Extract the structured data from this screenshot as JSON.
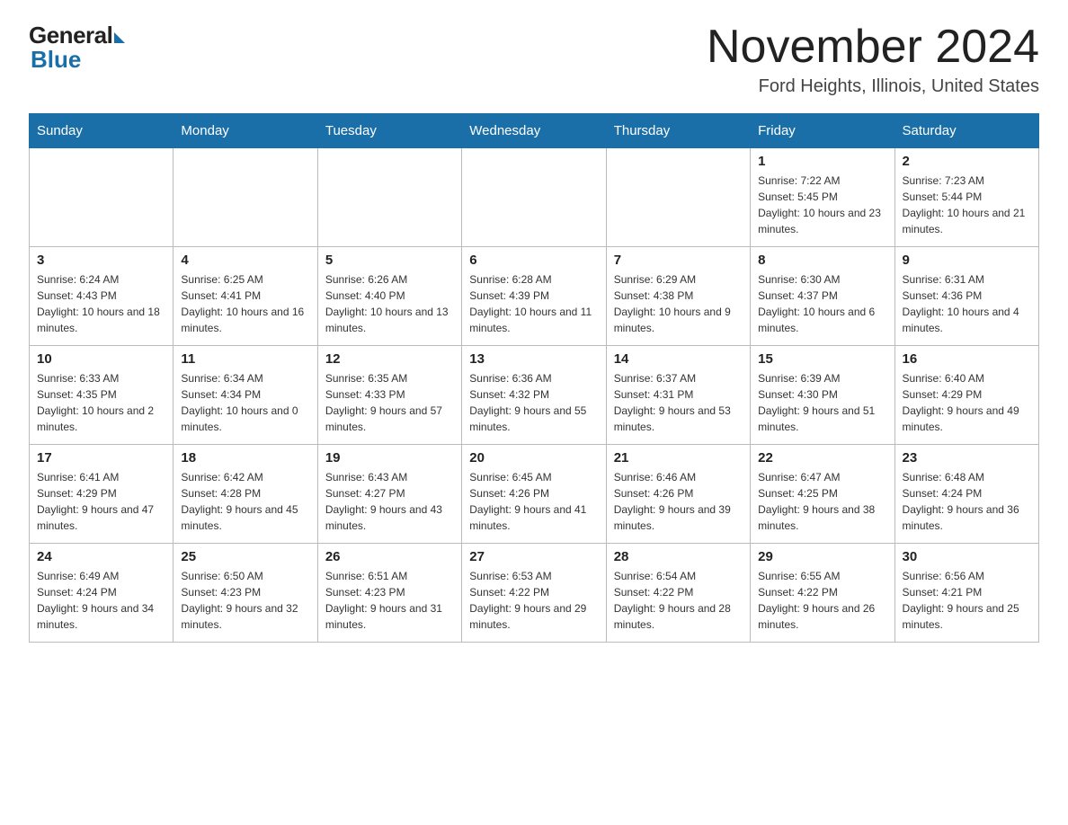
{
  "logo": {
    "general": "General",
    "blue": "Blue"
  },
  "title": {
    "month_year": "November 2024",
    "location": "Ford Heights, Illinois, United States"
  },
  "weekdays": [
    "Sunday",
    "Monday",
    "Tuesday",
    "Wednesday",
    "Thursday",
    "Friday",
    "Saturday"
  ],
  "weeks": [
    [
      {
        "day": "",
        "info": ""
      },
      {
        "day": "",
        "info": ""
      },
      {
        "day": "",
        "info": ""
      },
      {
        "day": "",
        "info": ""
      },
      {
        "day": "",
        "info": ""
      },
      {
        "day": "1",
        "info": "Sunrise: 7:22 AM\nSunset: 5:45 PM\nDaylight: 10 hours and 23 minutes."
      },
      {
        "day": "2",
        "info": "Sunrise: 7:23 AM\nSunset: 5:44 PM\nDaylight: 10 hours and 21 minutes."
      }
    ],
    [
      {
        "day": "3",
        "info": "Sunrise: 6:24 AM\nSunset: 4:43 PM\nDaylight: 10 hours and 18 minutes."
      },
      {
        "day": "4",
        "info": "Sunrise: 6:25 AM\nSunset: 4:41 PM\nDaylight: 10 hours and 16 minutes."
      },
      {
        "day": "5",
        "info": "Sunrise: 6:26 AM\nSunset: 4:40 PM\nDaylight: 10 hours and 13 minutes."
      },
      {
        "day": "6",
        "info": "Sunrise: 6:28 AM\nSunset: 4:39 PM\nDaylight: 10 hours and 11 minutes."
      },
      {
        "day": "7",
        "info": "Sunrise: 6:29 AM\nSunset: 4:38 PM\nDaylight: 10 hours and 9 minutes."
      },
      {
        "day": "8",
        "info": "Sunrise: 6:30 AM\nSunset: 4:37 PM\nDaylight: 10 hours and 6 minutes."
      },
      {
        "day": "9",
        "info": "Sunrise: 6:31 AM\nSunset: 4:36 PM\nDaylight: 10 hours and 4 minutes."
      }
    ],
    [
      {
        "day": "10",
        "info": "Sunrise: 6:33 AM\nSunset: 4:35 PM\nDaylight: 10 hours and 2 minutes."
      },
      {
        "day": "11",
        "info": "Sunrise: 6:34 AM\nSunset: 4:34 PM\nDaylight: 10 hours and 0 minutes."
      },
      {
        "day": "12",
        "info": "Sunrise: 6:35 AM\nSunset: 4:33 PM\nDaylight: 9 hours and 57 minutes."
      },
      {
        "day": "13",
        "info": "Sunrise: 6:36 AM\nSunset: 4:32 PM\nDaylight: 9 hours and 55 minutes."
      },
      {
        "day": "14",
        "info": "Sunrise: 6:37 AM\nSunset: 4:31 PM\nDaylight: 9 hours and 53 minutes."
      },
      {
        "day": "15",
        "info": "Sunrise: 6:39 AM\nSunset: 4:30 PM\nDaylight: 9 hours and 51 minutes."
      },
      {
        "day": "16",
        "info": "Sunrise: 6:40 AM\nSunset: 4:29 PM\nDaylight: 9 hours and 49 minutes."
      }
    ],
    [
      {
        "day": "17",
        "info": "Sunrise: 6:41 AM\nSunset: 4:29 PM\nDaylight: 9 hours and 47 minutes."
      },
      {
        "day": "18",
        "info": "Sunrise: 6:42 AM\nSunset: 4:28 PM\nDaylight: 9 hours and 45 minutes."
      },
      {
        "day": "19",
        "info": "Sunrise: 6:43 AM\nSunset: 4:27 PM\nDaylight: 9 hours and 43 minutes."
      },
      {
        "day": "20",
        "info": "Sunrise: 6:45 AM\nSunset: 4:26 PM\nDaylight: 9 hours and 41 minutes."
      },
      {
        "day": "21",
        "info": "Sunrise: 6:46 AM\nSunset: 4:26 PM\nDaylight: 9 hours and 39 minutes."
      },
      {
        "day": "22",
        "info": "Sunrise: 6:47 AM\nSunset: 4:25 PM\nDaylight: 9 hours and 38 minutes."
      },
      {
        "day": "23",
        "info": "Sunrise: 6:48 AM\nSunset: 4:24 PM\nDaylight: 9 hours and 36 minutes."
      }
    ],
    [
      {
        "day": "24",
        "info": "Sunrise: 6:49 AM\nSunset: 4:24 PM\nDaylight: 9 hours and 34 minutes."
      },
      {
        "day": "25",
        "info": "Sunrise: 6:50 AM\nSunset: 4:23 PM\nDaylight: 9 hours and 32 minutes."
      },
      {
        "day": "26",
        "info": "Sunrise: 6:51 AM\nSunset: 4:23 PM\nDaylight: 9 hours and 31 minutes."
      },
      {
        "day": "27",
        "info": "Sunrise: 6:53 AM\nSunset: 4:22 PM\nDaylight: 9 hours and 29 minutes."
      },
      {
        "day": "28",
        "info": "Sunrise: 6:54 AM\nSunset: 4:22 PM\nDaylight: 9 hours and 28 minutes."
      },
      {
        "day": "29",
        "info": "Sunrise: 6:55 AM\nSunset: 4:22 PM\nDaylight: 9 hours and 26 minutes."
      },
      {
        "day": "30",
        "info": "Sunrise: 6:56 AM\nSunset: 4:21 PM\nDaylight: 9 hours and 25 minutes."
      }
    ]
  ]
}
